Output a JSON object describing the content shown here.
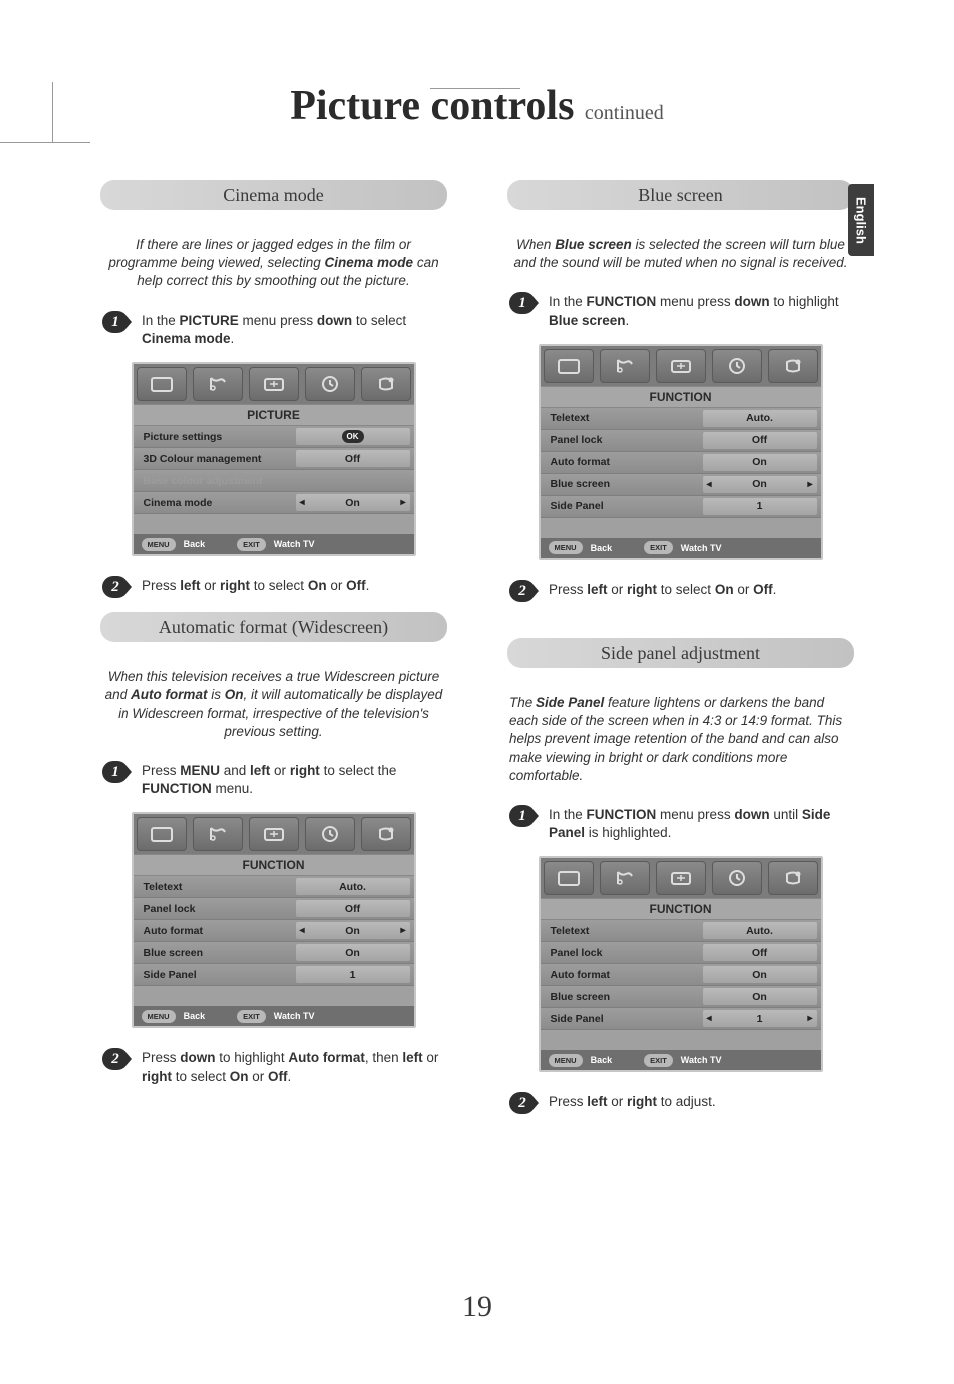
{
  "lang_tab": "English",
  "page_title_main": "Picture controls",
  "page_title_cont": "continued",
  "page_number": "19",
  "osd_footer": {
    "menu": "MENU",
    "back": "Back",
    "exit": "EXIT",
    "watch": "Watch TV"
  },
  "cinema": {
    "heading": "Cinema mode",
    "intro_pre": "If there are lines or jagged edges in the film or programme being viewed, selecting ",
    "intro_bold": "Cinema mode",
    "intro_post": " can help correct this by smoothing out the picture.",
    "step1_a": "In the ",
    "step1_b1": "PICTURE",
    "step1_c": " menu press ",
    "step1_b2": "down",
    "step1_d": " to select ",
    "step1_b3": "Cinema mode",
    "step1_e": ".",
    "menu_title": "PICTURE",
    "rows": {
      "r1_label": "Picture settings",
      "r1_val": "OK",
      "r2_label": "3D Colour management",
      "r2_val": "Off",
      "r3_label": "Base colour adjustment",
      "r4_label": "Cinema mode",
      "r4_val": "On"
    },
    "step2_a": "Press ",
    "step2_b1": "left",
    "step2_b": " or ",
    "step2_b2": "right",
    "step2_c": " to select ",
    "step2_b3": "On",
    "step2_d": " or ",
    "step2_b4": "Off",
    "step2_e": "."
  },
  "autoformat": {
    "heading": "Automatic format (Widescreen)",
    "intro_a": "When this television receives a true Widescreen picture and ",
    "intro_b1": "Auto format",
    "intro_b": " is ",
    "intro_b2": "On",
    "intro_c": ", it will automatically be displayed in Widescreen format, irrespective of the television's previous setting.",
    "step1_a": "Press ",
    "step1_b1": "MENU",
    "step1_b": " and ",
    "step1_b2": "left",
    "step1_c": " or ",
    "step1_b3": "right",
    "step1_d": " to select the ",
    "step1_b4": "FUNCTION",
    "step1_e": " menu.",
    "menu_title": "FUNCTION",
    "rows": {
      "r1_label": "Teletext",
      "r1_val": "Auto.",
      "r2_label": "Panel lock",
      "r2_val": "Off",
      "r3_label": "Auto format",
      "r3_val": "On",
      "r4_label": "Blue screen",
      "r4_val": "On",
      "r5_label": "Side Panel",
      "r5_val": "1"
    },
    "step2_a": "Press ",
    "step2_b1": "down",
    "step2_b": " to highlight ",
    "step2_b2": "Auto format",
    "step2_c": ", then ",
    "step2_b3": "left",
    "step2_d": " or ",
    "step2_b4": "right",
    "step2_e": " to select ",
    "step2_b5": "On",
    "step2_f": " or ",
    "step2_b6": "Off",
    "step2_g": "."
  },
  "bluescreen": {
    "heading": "Blue screen",
    "intro_a": "When ",
    "intro_b1": "Blue screen",
    "intro_b": " is selected the screen will turn blue and the sound will be muted when no signal is received.",
    "step1_a": "In the ",
    "step1_b1": "FUNCTION",
    "step1_b": " menu press ",
    "step1_b2": "down",
    "step1_c": " to highlight ",
    "step1_b3": "Blue screen",
    "step1_d": ".",
    "menu_title": "FUNCTION",
    "rows": {
      "r1_label": "Teletext",
      "r1_val": "Auto.",
      "r2_label": "Panel lock",
      "r2_val": "Off",
      "r3_label": "Auto format",
      "r3_val": "On",
      "r4_label": "Blue screen",
      "r4_val": "On",
      "r5_label": "Side Panel",
      "r5_val": "1"
    },
    "step2_a": "Press ",
    "step2_b1": "left",
    "step2_b": " or ",
    "step2_b2": "right",
    "step2_c": " to select ",
    "step2_b3": "On",
    "step2_d": " or ",
    "step2_b4": "Off",
    "step2_e": "."
  },
  "sidepanel": {
    "heading": "Side panel adjustment",
    "intro_a": "The ",
    "intro_b1": "Side Panel",
    "intro_b": " feature lightens or darkens the band each side of the screen when in 4:3 or 14:9 format. This helps prevent image retention of the band and can also make viewing in bright or dark conditions more comfortable.",
    "step1_a": "In the ",
    "step1_b1": "FUNCTION",
    "step1_b": " menu press ",
    "step1_b2": "down",
    "step1_c": " until ",
    "step1_b3": "Side Panel",
    "step1_d": " is highlighted.",
    "menu_title": "FUNCTION",
    "rows": {
      "r1_label": "Teletext",
      "r1_val": "Auto.",
      "r2_label": "Panel lock",
      "r2_val": "Off",
      "r3_label": "Auto format",
      "r3_val": "On",
      "r4_label": "Blue screen",
      "r4_val": "On",
      "r5_label": "Side Panel",
      "r5_val": "1"
    },
    "step2_a": "Press ",
    "step2_b1": "left",
    "step2_b": " or ",
    "step2_b2": "right",
    "step2_c": " to adjust."
  }
}
